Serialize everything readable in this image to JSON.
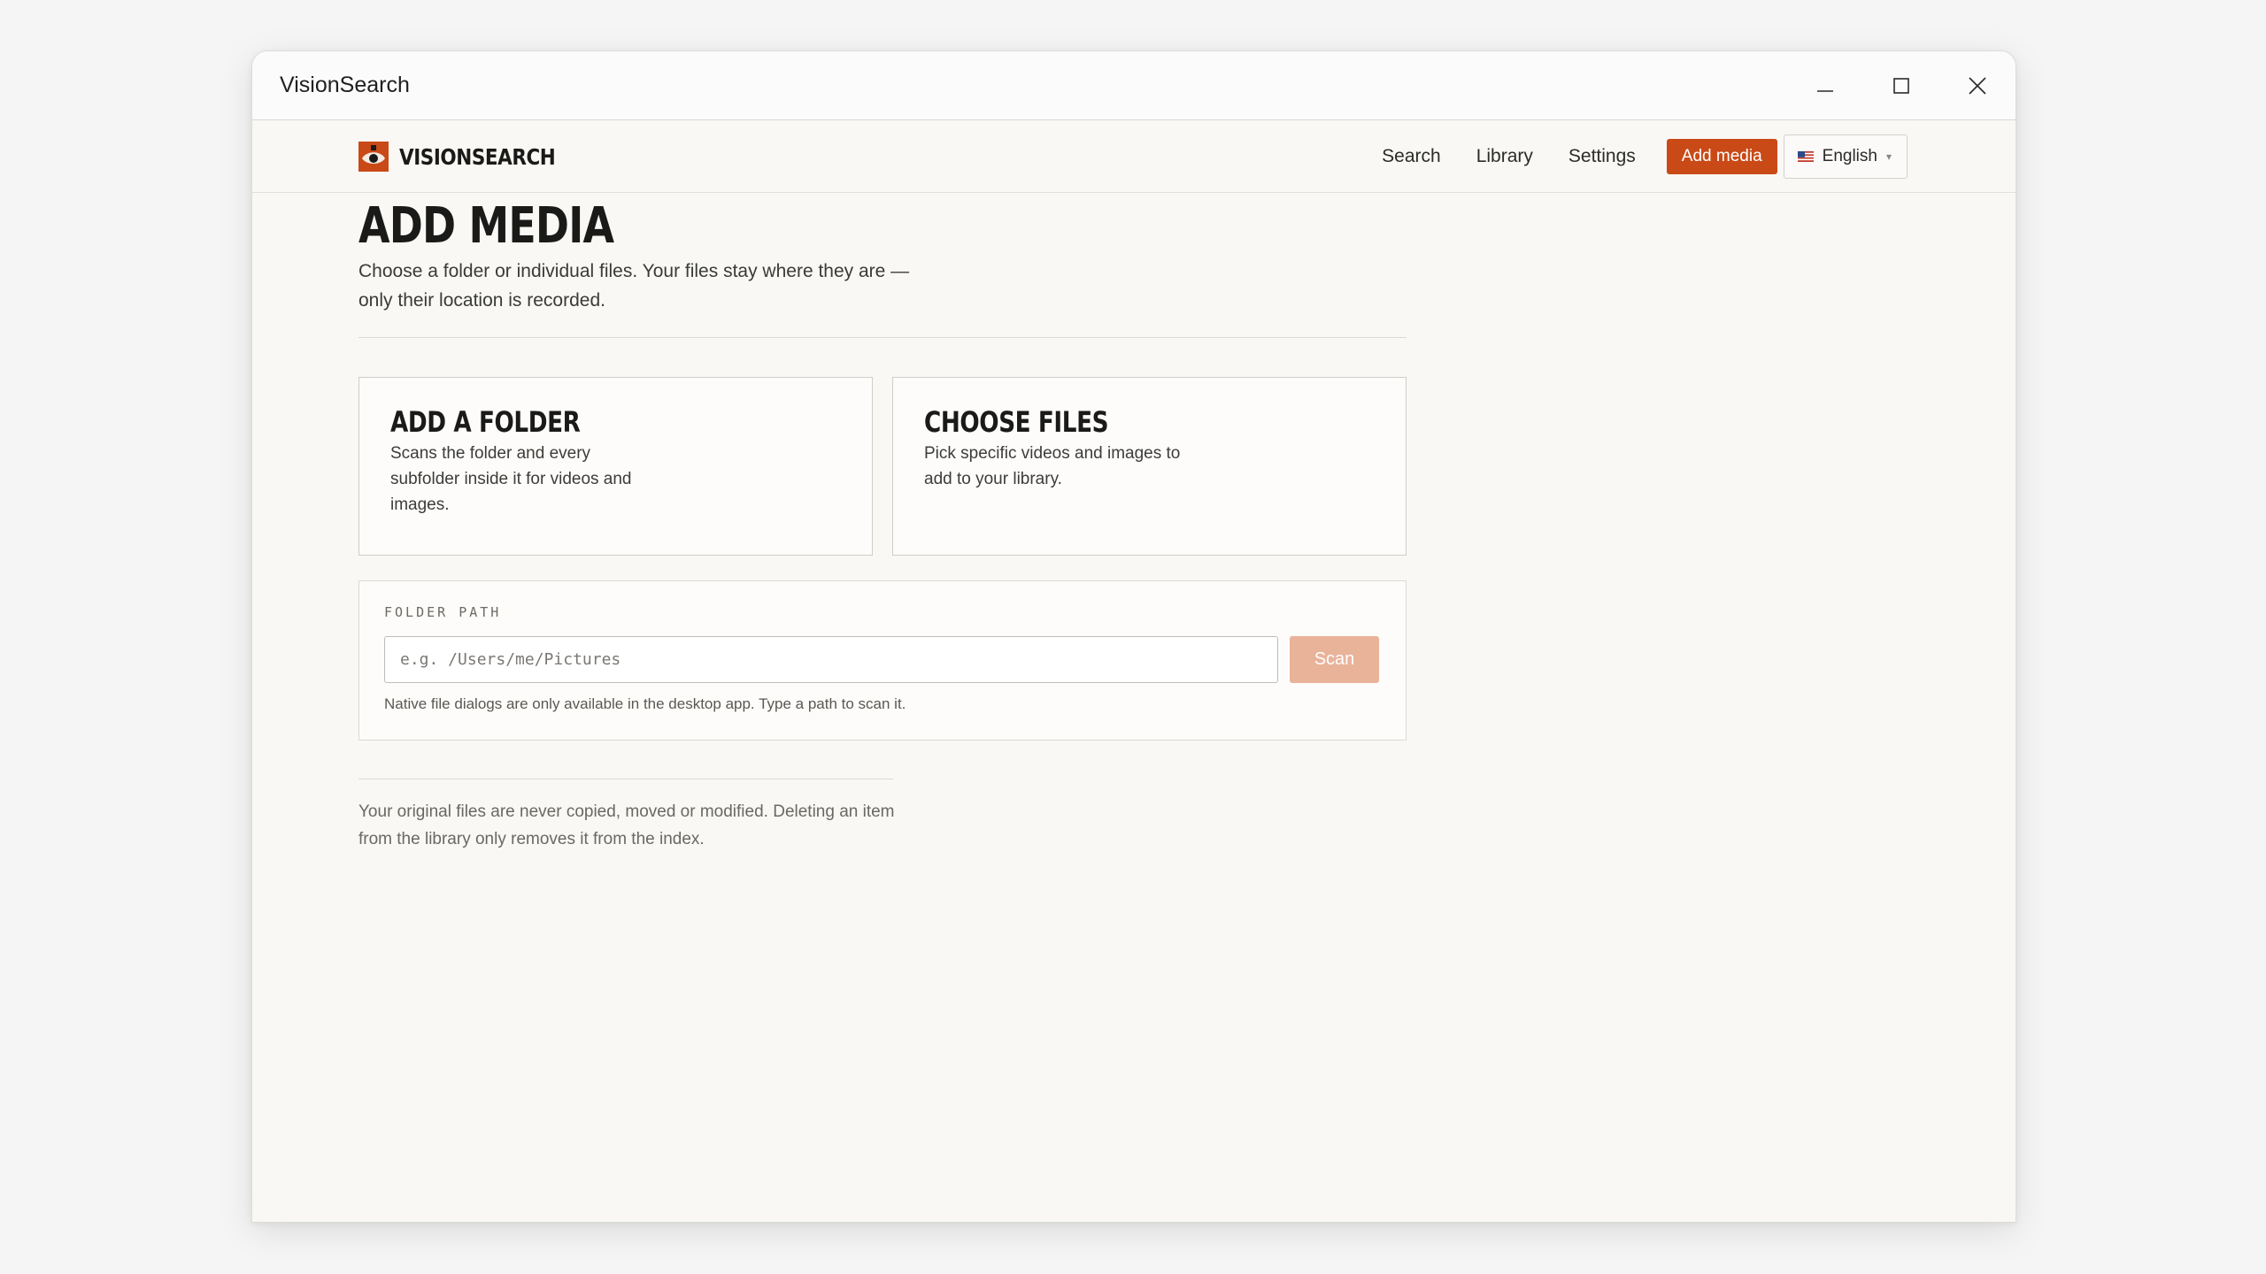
{
  "window": {
    "title": "VisionSearch",
    "controls": {
      "minimize_icon": "minimize-icon",
      "maximize_icon": "maximize-icon",
      "close_icon": "close-icon"
    }
  },
  "nav": {
    "brand": "VISIONSEARCH",
    "links": [
      "Search",
      "Library",
      "Settings"
    ],
    "cta": "Add media",
    "language": "English",
    "accent_color": "#c94a17"
  },
  "page": {
    "title": "ADD MEDIA",
    "subtitle": "Choose a folder or individual files. Your files stay where they are — only their location is recorded."
  },
  "cards": [
    {
      "title": "ADD A FOLDER",
      "description": "Scans the folder and every subfolder inside it for videos and images."
    },
    {
      "title": "CHOOSE FILES",
      "description": "Pick specific videos and images to add to your library."
    }
  ],
  "folder": {
    "label": "FOLDER PATH",
    "value": "",
    "placeholder": "e.g. /Users/me/Pictures",
    "scan_label": "Scan",
    "hint": "Native file dialogs are only available in the desktop app. Type a path to scan it."
  },
  "footer": {
    "note": "Your original files are never copied, moved or modified. Deleting an item from the library only removes it from the index."
  }
}
